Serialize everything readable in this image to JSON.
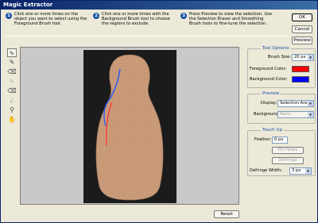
{
  "window": {
    "title": "Magic Extractor"
  },
  "instructions": [
    {
      "num": "1",
      "text": [
        "Click one or more times on the",
        "object you want to select using the",
        "Foreground Brush tool."
      ]
    },
    {
      "num": "2",
      "text": [
        "Click one or more times with the",
        "Background Brush tool to choose",
        "the regions to exclude."
      ]
    },
    {
      "num": "3",
      "text": [
        "Press Preview to view the selection. Use",
        "the Selection Eraser and Smoothing",
        "Brush tools to fine-tune the selection."
      ]
    }
  ],
  "buttons": {
    "ok": "OK",
    "cancel": "Cancel",
    "preview": "Preview",
    "reset": "Reset",
    "fill_holes": "Fill Holes",
    "defringe": "Defringe"
  },
  "tools": [
    {
      "name": "foreground-brush-icon",
      "glyph": "✎",
      "active": true
    },
    {
      "name": "background-brush-icon",
      "glyph": "✎",
      "active": false
    },
    {
      "name": "point-eraser-icon",
      "glyph": "⌫",
      "active": false
    },
    {
      "name": "add-to-selection-icon",
      "glyph": "✎",
      "active": false,
      "dim": true
    },
    {
      "name": "remove-from-selection-icon",
      "glyph": "⌫",
      "active": false
    },
    {
      "name": "smoothing-brush-icon",
      "glyph": "∠",
      "active": false,
      "dim": true
    },
    {
      "name": "zoom-icon",
      "glyph": "⚲",
      "active": false
    },
    {
      "name": "hand-icon",
      "glyph": "✋",
      "active": false
    }
  ],
  "tool_options": {
    "legend": "Tool Options",
    "brush_size_label": "Brush Size:",
    "brush_size_value": "20 px",
    "foreground_label": "Foreground Color:",
    "foreground_color": "#ff0000",
    "background_label": "Background Color:",
    "background_color": "#0000ff"
  },
  "preview": {
    "legend": "Preview",
    "display_label": "Display:",
    "display_value": "Selection Area",
    "background_label": "Background:",
    "background_value": "None"
  },
  "touch_up": {
    "legend": "Touch Up",
    "feather_label": "Feather:",
    "feather_value": "0 px",
    "defringe_width_label": "Defringe Width:",
    "defringe_width_value": "3 px"
  }
}
